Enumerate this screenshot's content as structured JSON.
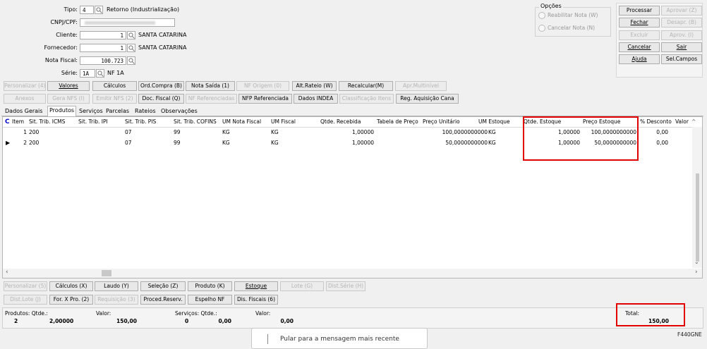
{
  "header": {
    "tipo_label": "Tipo:",
    "tipo_value": "4",
    "tipo_desc": "Retorno (Industrialização)",
    "cnpj_label": "CNPJ/CPF:",
    "cliente_label": "Cliente:",
    "cliente_value": "1",
    "cliente_desc": "SANTA CATARINA",
    "fornecedor_label": "Fornecedor:",
    "fornecedor_value": "1",
    "fornecedor_desc": "SANTA CATARINA",
    "nota_label": "Nota Fiscal:",
    "nota_value": "100.723",
    "serie_label": "Série:",
    "serie_value": "1A",
    "serie_desc": "NF 1A"
  },
  "opcoes": {
    "title": "Opções",
    "opt1": "Reabilitar Nota (W)",
    "opt2": "Cancelar Nota (N)"
  },
  "right_buttons": [
    "Processar",
    "Aprovar (Z)",
    "Fechar",
    "Desapr. (B)",
    "Excluir",
    "Aprov. (I)",
    "Cancelar",
    "Sair",
    "Ajuda",
    "Sel.Campos"
  ],
  "toolbar_row1": [
    "Personalizar (4)",
    "Valores",
    "Cálculos",
    "Ord.Compra (B)",
    "Nota Saída (1)",
    "NF Origem (0)",
    "Alt.Rateio (W)",
    "Recalcular(M)",
    "Apr.Multinível"
  ],
  "toolbar_row2": [
    "Anexos",
    "Gera NFS (I)",
    "Emitir NFS (2)",
    "Doc. Fiscal (Q)",
    "NF Referenciadas",
    "NFP Referenciada",
    "Dados INDEA",
    "Classificação Itens",
    "Reg. Aquisição Cana"
  ],
  "tabs": [
    "Dados Gerais",
    "Produtos",
    "Serviços",
    "Parcelas",
    "Rateios",
    "Observações"
  ],
  "grid": {
    "corner": "C",
    "columns": [
      "Item",
      "Sit. Trib. ICMS",
      "Sit. Trib. IPI",
      "Sit. Trib. PIS",
      "Sit. Trib. COFINS",
      "UM Nota Fiscal",
      "UM Fiscal",
      "Qtde. Recebida",
      "Tabela de Preço",
      "Preço Unitário",
      "UM Estoque",
      "Qtde. Estoque",
      "Preço Estoque",
      "% Desconto",
      "Valor I"
    ],
    "rows": [
      [
        "1",
        "200",
        "",
        "07",
        "99",
        "KG",
        "KG",
        "1,00000",
        "",
        "100,0000000000",
        "KG",
        "1,00000",
        "100,0000000000",
        "0,00",
        ""
      ],
      [
        "2",
        "200",
        "",
        "07",
        "99",
        "KG",
        "KG",
        "1,00000",
        "",
        "50,0000000000",
        "KG",
        "1,00000",
        "50,0000000000",
        "0,00",
        ""
      ]
    ]
  },
  "bottom_row1": [
    "Personalizar (5)",
    "Cálculos (X)",
    "Laudo (Y)",
    "Seleção (Z)",
    "Produto (K)",
    "Estoque",
    "Lote (G)",
    "Dist.Série (H)"
  ],
  "bottom_row2": [
    "Dist.Lote (J)",
    "For. X Pro. (2)",
    "Requisição (3)",
    "Proced.Reserv.",
    "Espelho NF",
    "Dis. Fiscais (6)"
  ],
  "footer": {
    "produtos_label": "Produtos: Qtde.:",
    "produtos_qtde": "2",
    "produtos_qtde_val": "2,00000",
    "valor_label": "Valor:",
    "valor": "150,00",
    "servicos_label": "Serviços: Qtde.:",
    "servicos_qtde": "0",
    "servicos_valor_q": "0,00",
    "valor2_label": "Valor:",
    "valor2": "0,00",
    "total_label": "Total:",
    "total": "150,00"
  },
  "toast": "Pular para a mensagem mais recente",
  "screen_code": "F440GNE",
  "colors": {
    "highlight": "#e00000"
  }
}
